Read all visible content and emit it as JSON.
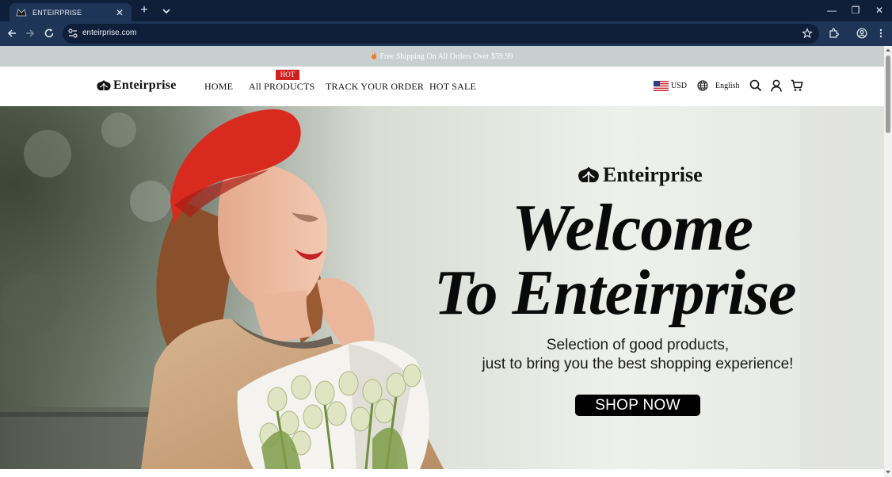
{
  "browser": {
    "tab_title": "ENTEIRPRISE",
    "tab_close": "✕",
    "new_tab": "+",
    "url": "enteirprise.com",
    "window_minimize": "—",
    "window_restore": "❐",
    "window_close": "✕"
  },
  "announcement": {
    "text": "Free Shipping On All Orders Over $59.99"
  },
  "header": {
    "logo": "Enteirprise",
    "nav": [
      {
        "label": "HOME"
      },
      {
        "label": "All PRODUCTS",
        "badge": "HOT"
      },
      {
        "label": "TRACK YOUR ORDER"
      },
      {
        "label": "HOT SALE"
      }
    ],
    "currency": "USD",
    "language": "English",
    "icons": [
      "search-icon",
      "account-icon",
      "cart-icon"
    ]
  },
  "hero": {
    "logo": "Enteirprise",
    "headline_line1": "Welcome",
    "headline_line2": "To Enteirprise",
    "tagline_line1": "Selection of good products,",
    "tagline_line2": "just to bring you the best shopping experience!",
    "cta": "SHOP NOW"
  },
  "colors": {
    "chrome_dark": "#0f1f3a",
    "chrome_toolbar": "#1e3558",
    "announcement_bg": "#c7cfcf",
    "hot_badge": "#cf1f1f",
    "cta_bg": "#000000"
  }
}
